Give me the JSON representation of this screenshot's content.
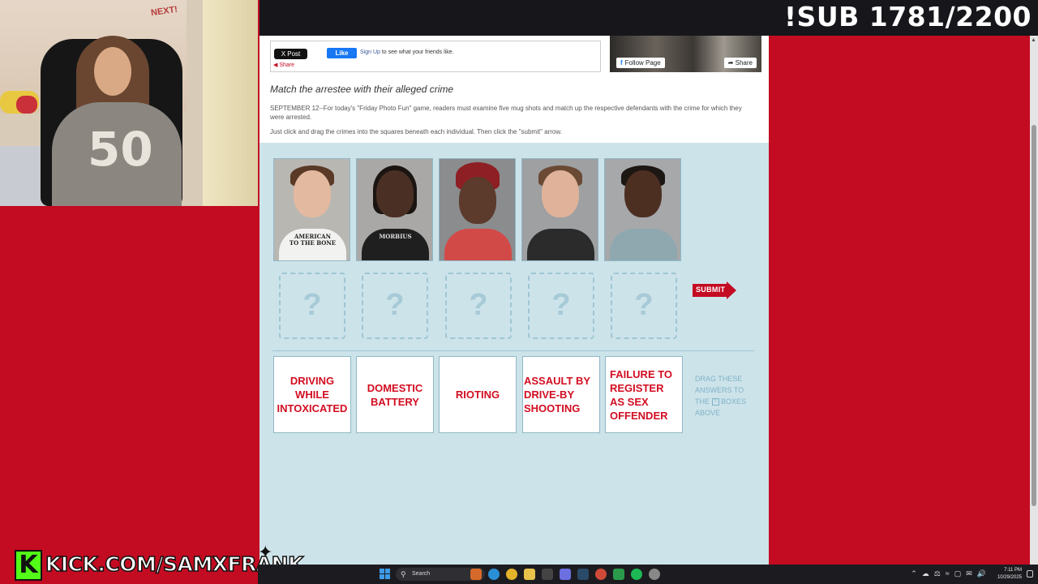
{
  "overlay": {
    "sub_counter": "!SUB 1781/2200",
    "kick_logo": "K",
    "kick_url": "KICK.COM/SAMXFRANK"
  },
  "social": {
    "x_post": "X Post",
    "fb_like": "Like",
    "fb_signup_link": "Sign Up",
    "fb_signup_text": " to see what your friends like.",
    "share": "Share",
    "follow_page": "Follow Page",
    "share_button": "Share"
  },
  "article": {
    "headline": "Match the arrestee with their alleged crime",
    "intro": "SEPTEMBER 12--For today's \"Friday Photo Fun\" game, readers must examine five mug shots and match up the respective defendants with the crime for which they were arrested.",
    "instructions": "Just click and drag the crimes into the squares beneath each individual. Then click the \"submit\" arrow."
  },
  "game": {
    "mugshots": [
      {
        "shirt_text": "AMERICAN\nTO THE BONE"
      },
      {
        "shirt_text": "MORBIUS"
      },
      {
        "shirt_text": ""
      },
      {
        "shirt_text": ""
      },
      {
        "shirt_text": ""
      }
    ],
    "drop_placeholder": "?",
    "submit_label": "SUBMIT",
    "crimes": [
      "DRIVING WHILE INTOXICATED",
      "DOMESTIC BATTERY",
      "RIOTING",
      "ASSAULT BY DRIVE-BY SHOOTING",
      "FAILURE TO REGISTER AS SEX OFFENDER"
    ],
    "drag_hint_pre": "DRAG THESE ANSWERS TO THE",
    "drag_hint_box": "?",
    "drag_hint_post": "BOXES ABOVE"
  },
  "webcam": {
    "wall_text": "NEXT!",
    "shirt_number": "50"
  },
  "taskbar": {
    "search_placeholder": "Search",
    "time": "7:11 PM",
    "date": "10/29/2025"
  },
  "colors": {
    "background_red": "#c30b22",
    "game_bg": "#cde3ea",
    "crime_text": "#d20d21",
    "kick_green": "#53fc18"
  }
}
